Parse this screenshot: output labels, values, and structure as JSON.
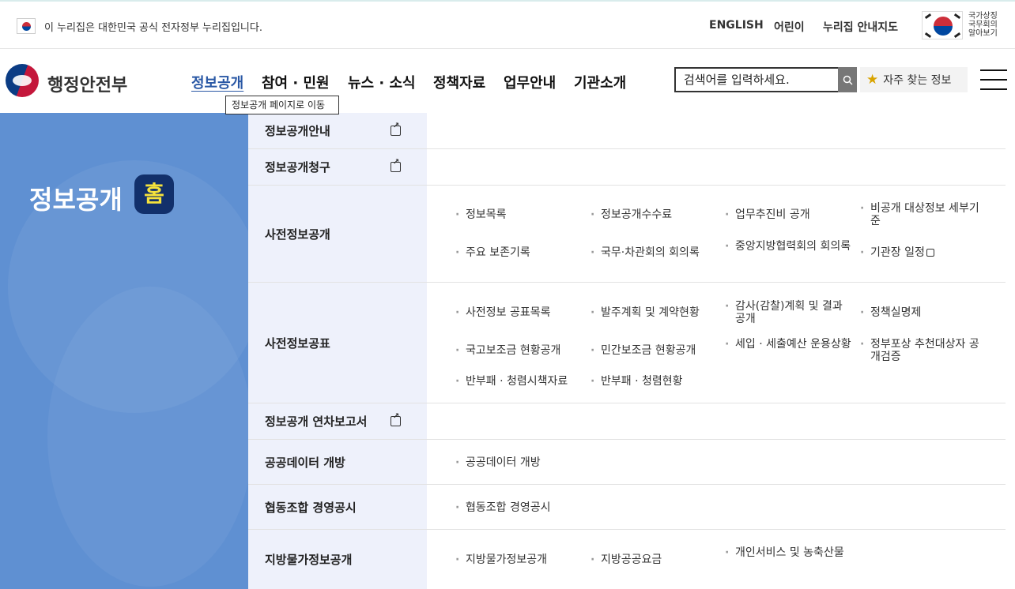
{
  "topbar": {
    "gov_notice": "이 누리집은 대한민국 공식 전자정부 누리집입니다.",
    "links": [
      "ENGLISH",
      "어린이",
      "누리집 안내지도"
    ],
    "emblem_lines": [
      "국가상징",
      "국무회의",
      "알아보기"
    ]
  },
  "header": {
    "logo_text": "행정안전부",
    "gnb": [
      "정보공개",
      "참여 · 민원",
      "뉴스 · 소식",
      "정책자료",
      "업무안내",
      "기관소개"
    ],
    "tooltip": "정보공개 페이지로 이동",
    "search_placeholder": "검색어를 입력하세요.",
    "favorite_label": "자주 찾는 정보"
  },
  "side": {
    "title": "정보공개",
    "home_badge": "홈"
  },
  "menu": [
    {
      "label": "정보공개안내",
      "external": true,
      "items": []
    },
    {
      "label": "정보공개청구",
      "external": true,
      "items": []
    },
    {
      "label": "사전정보공개",
      "external": false,
      "items": [
        "정보목록",
        "정보공개수수료",
        "업무추진비 공개",
        "비공개 대상정보 세부기준",
        "주요 보존기록",
        "국무·차관회의 회의록",
        "중앙지방협력회의 회의록",
        "기관장 일정"
      ]
    },
    {
      "label": "사전정보공표",
      "external": false,
      "items": [
        "사전정보 공표목록",
        "발주계획 및 계약현황",
        "감사(감찰)계획 및 결과공개",
        "정책실명제",
        "국고보조금 현황공개",
        "민간보조금 현황공개",
        "세입 · 세출예산 운용상황",
        "정부포상 추천대상자 공개검증",
        "반부패 · 청렴시책자료",
        "반부패 · 청렴현황"
      ]
    },
    {
      "label": "정보공개 연차보고서",
      "external": true,
      "items": []
    },
    {
      "label": "공공데이터 개방",
      "external": false,
      "items": [
        "공공데이터 개방"
      ]
    },
    {
      "label": "협동조합 경영공시",
      "external": false,
      "items": [
        "협동조합 경영공시"
      ]
    },
    {
      "label": "지방물가정보공개",
      "external": false,
      "items": [
        "지방물가정보공개",
        "지방공공요금",
        "개인서비스 및 농축산물"
      ]
    }
  ]
}
